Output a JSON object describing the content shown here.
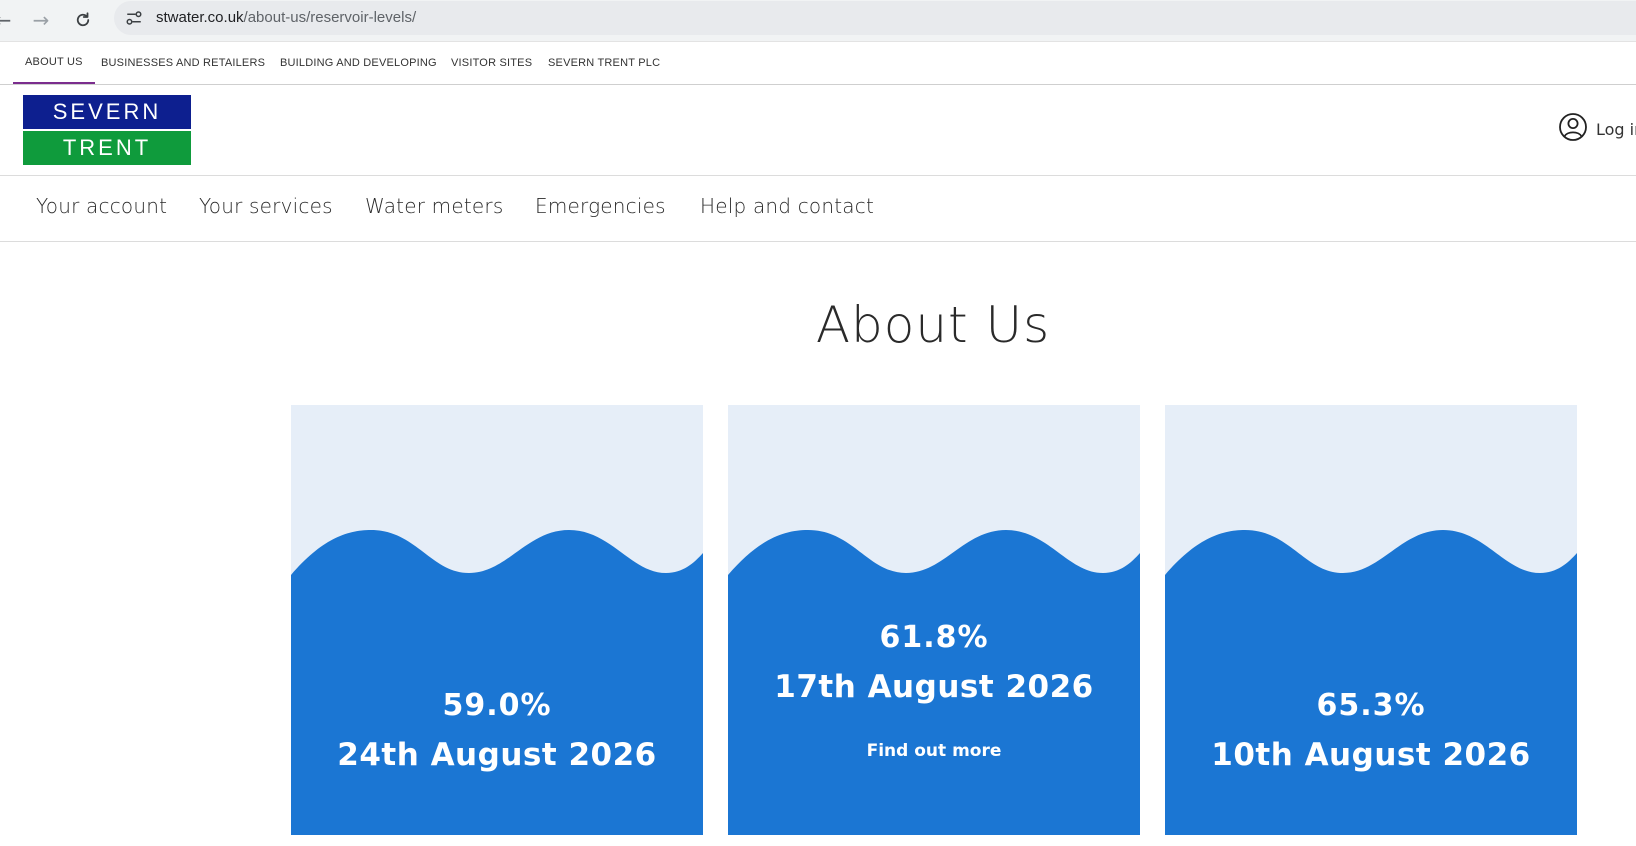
{
  "browser": {
    "url_host": "stwater.co.uk",
    "url_path": "/about-us/reservoir-levels/"
  },
  "utility_nav": {
    "items": [
      {
        "label": "ABOUT US",
        "active": true
      },
      {
        "label": "BUSINESSES AND RETAILERS",
        "active": false
      },
      {
        "label": "BUILDING AND DEVELOPING",
        "active": false
      },
      {
        "label": "VISITOR SITES",
        "active": false
      },
      {
        "label": "SEVERN TRENT PLC",
        "active": false
      }
    ]
  },
  "header": {
    "logo_top": "SEVERN",
    "logo_bottom": "TRENT",
    "login_label": "Log in",
    "colors": {
      "logo_blue": "#0d1f8f",
      "logo_green": "#0f9b3c"
    }
  },
  "main_nav": {
    "items": [
      {
        "label": "Your account"
      },
      {
        "label": "Your services"
      },
      {
        "label": "Water meters"
      },
      {
        "label": "Emergencies"
      },
      {
        "label": "Help and contact"
      }
    ]
  },
  "page": {
    "title": "About Us"
  },
  "cards": [
    {
      "percent": "59.0%",
      "date": "24th August 2026",
      "link": ""
    },
    {
      "percent": "61.8%",
      "date": "17th August 2026",
      "link": "Find out more"
    },
    {
      "percent": "65.3%",
      "date": "10th August 2026",
      "link": ""
    }
  ],
  "colors": {
    "water": "#1b76d3",
    "card_background": "#e6eef8",
    "active_underline": "#7b2d8e"
  }
}
